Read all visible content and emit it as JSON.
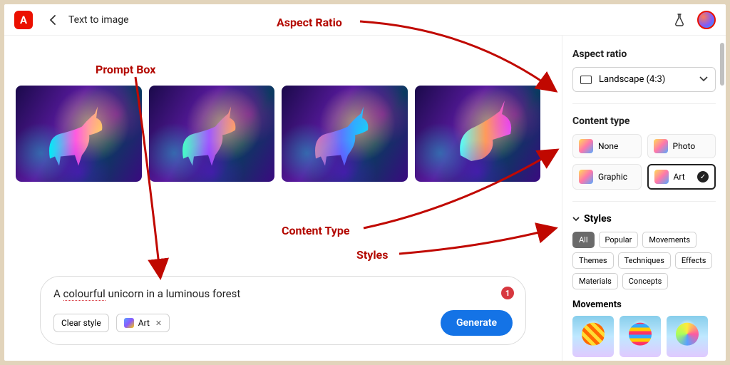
{
  "header": {
    "brand_letter": "A",
    "title": "Text to image"
  },
  "annotations": {
    "prompt_box": "Prompt Box",
    "aspect_ratio": "Aspect Ratio",
    "content_type": "Content Type",
    "styles": "Styles"
  },
  "prompt": {
    "text_pre": "A ",
    "text_underlined": "colourful",
    "text_post": " unicorn in a luminous forest",
    "badge": "1",
    "clear_style_label": "Clear style",
    "style_chip_label": "Art",
    "generate_label": "Generate"
  },
  "sidebar": {
    "aspect_ratio": {
      "title": "Aspect ratio",
      "selected": "Landscape (4:3)"
    },
    "content_type": {
      "title": "Content type",
      "options": [
        {
          "label": "None",
          "selected": false
        },
        {
          "label": "Photo",
          "selected": false
        },
        {
          "label": "Graphic",
          "selected": false
        },
        {
          "label": "Art",
          "selected": true
        }
      ]
    },
    "styles": {
      "title": "Styles",
      "filters": [
        "All",
        "Popular",
        "Movements",
        "Themes",
        "Techniques",
        "Effects",
        "Materials",
        "Concepts"
      ],
      "active_filter": "All",
      "subsection": "Movements"
    }
  }
}
